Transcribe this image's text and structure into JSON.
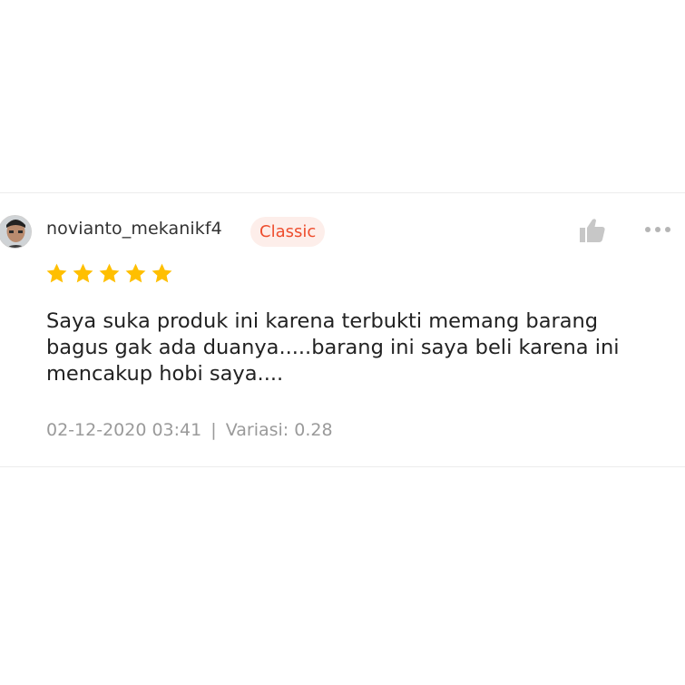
{
  "review": {
    "username": "novianto_mekanikf4",
    "badge": "Classic",
    "rating": 5,
    "comment_lines": [
      "Saya suka produk ini karena terbukti memang barang",
      "bagus gak ada duanya.....barang ini saya beli karena ini",
      "mencakup hobi saya...."
    ],
    "date": "02-12-2020 03:41",
    "separator": "|",
    "variation": "Variasi: 0.28",
    "icons": {
      "like": "thumbs-up-icon",
      "more": "more-horizontal-icon",
      "star": "star-icon"
    },
    "colors": {
      "star": "#ffbf00",
      "badge_text": "#ee4d2d",
      "badge_bg": "#fdeeea"
    }
  }
}
